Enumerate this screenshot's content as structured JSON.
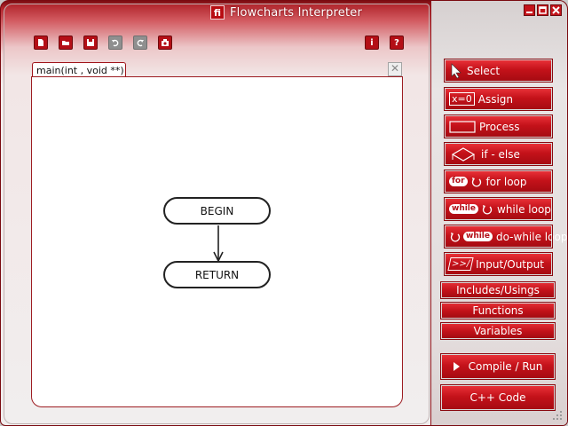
{
  "app": {
    "logo": "fi",
    "title": "Flowcharts Interpreter"
  },
  "window_controls": [
    {
      "name": "minimize",
      "glyph": "▁"
    },
    {
      "name": "maximize",
      "glyph": "□"
    },
    {
      "name": "close",
      "glyph": "✕"
    }
  ],
  "toolbar": {
    "icons": [
      "new-file-icon",
      "open-folder-icon",
      "save-icon",
      "undo-icon",
      "redo-icon",
      "screenshot-icon"
    ],
    "info_glyph": "i",
    "help_glyph": "?"
  },
  "editor": {
    "tab_label": "main(int ,  void **)",
    "close_glyph": "✕",
    "nodes": {
      "begin": "BEGIN",
      "return": "RETURN"
    }
  },
  "palette": {
    "select": "Select",
    "assign_icon_text": "x=0",
    "assign": "Assign",
    "process": "Process",
    "if_else": "if - else",
    "for_icon_text": "for",
    "for_loop": "for loop",
    "while_icon_text": "while",
    "while_loop": "while loop",
    "do_while_icon_text": "while",
    "do_while_loop": "do-while loop",
    "io_icon_text": ">>/",
    "input_output": "Input/Output"
  },
  "sections": {
    "includes": "Includes/Usings",
    "functions": "Functions",
    "variables": "Variables"
  },
  "actions": {
    "compile_run": "Compile / Run",
    "cpp_code": "C++ Code"
  },
  "colors": {
    "accent": "#c4121a",
    "accent_dark": "#8a0a10",
    "canvas_bg": "#ffffff"
  }
}
